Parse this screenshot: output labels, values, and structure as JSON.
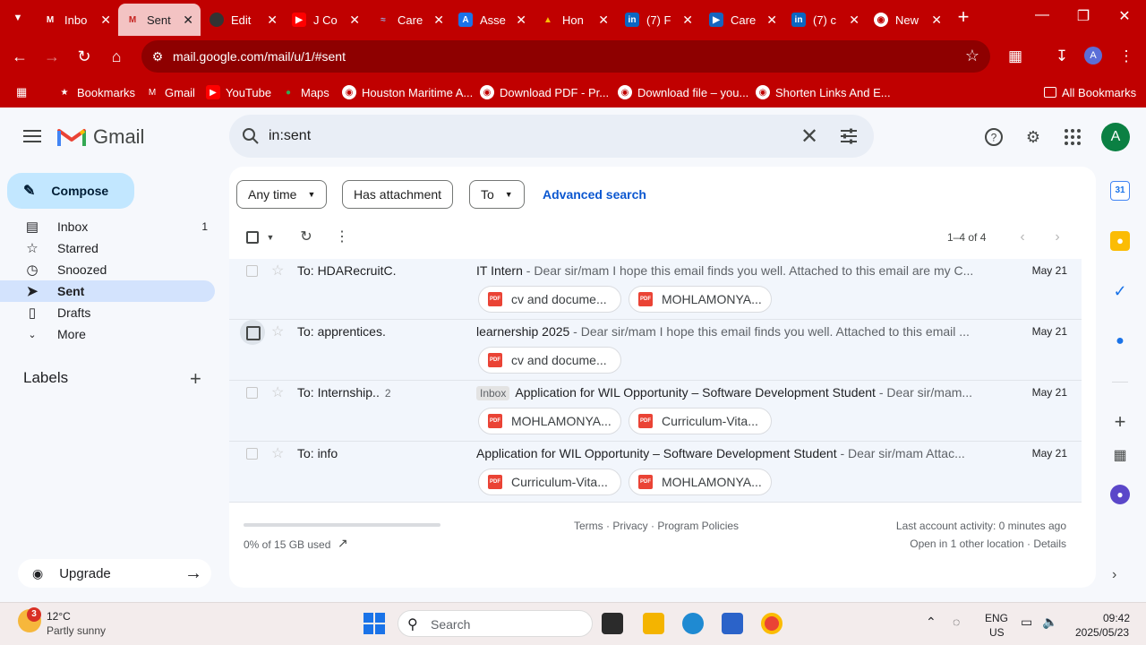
{
  "browser": {
    "tabs": [
      {
        "title": "Inbo",
        "favicon": "gmail-icon"
      },
      {
        "title": "Sent",
        "favicon": "gmail-icon"
      },
      {
        "title": "Edit",
        "favicon": "github-icon"
      },
      {
        "title": "J Co",
        "favicon": "youtube-icon"
      },
      {
        "title": "Care",
        "favicon": "career-icon"
      },
      {
        "title": "Asse",
        "favicon": "assessment-icon"
      },
      {
        "title": "Hon",
        "favicon": "drive-icon"
      },
      {
        "title": "(7) F",
        "favicon": "linkedin-icon"
      },
      {
        "title": "Care",
        "favicon": "career-icon"
      },
      {
        "title": "(7) c",
        "favicon": "linkedin-icon"
      },
      {
        "title": "New",
        "favicon": "chrome-icon"
      }
    ],
    "url": "mail.google.com/mail/u/1/#sent",
    "profile_initial": "A",
    "bookmarks": [
      "Bookmarks",
      "Gmail",
      "YouTube",
      "Maps",
      "Houston Maritime A...",
      "Download PDF - Pr...",
      "Download file – you...",
      "Shorten Links And E..."
    ],
    "all_bookmarks": "All Bookmarks",
    "theme_color": "#c00000"
  },
  "gmail": {
    "brand": "Gmail",
    "search_query": "in:sent",
    "avatar_initial": "A",
    "compose_label": "Compose",
    "nav": [
      {
        "label": "Inbox",
        "icon": "inbox-icon",
        "count": "1"
      },
      {
        "label": "Starred",
        "icon": "star-icon",
        "count": ""
      },
      {
        "label": "Snoozed",
        "icon": "clock-icon",
        "count": ""
      },
      {
        "label": "Sent",
        "icon": "send-icon",
        "count": ""
      },
      {
        "label": "Drafts",
        "icon": "draft-icon",
        "count": ""
      },
      {
        "label": "More",
        "icon": "chevron-down-icon",
        "count": ""
      }
    ],
    "labels_heading": "Labels",
    "upgrade_label": "Upgrade",
    "filters": {
      "any_time": "Any time",
      "has_attachment": "Has attachment",
      "to": "To",
      "advanced": "Advanced search"
    },
    "pager": "1–4 of 4",
    "emails": [
      {
        "to": "To: HDARecruitC.",
        "count": "",
        "tag": "",
        "subject": "IT Intern",
        "snippet": " - Dear sir/mam I hope this email finds you well. Attached to this email are my C...",
        "date": "May 21",
        "attachments": [
          "cv and docume...",
          "MOHLAMONYA..."
        ]
      },
      {
        "to": "To: apprentices.",
        "count": "",
        "tag": "",
        "subject": "learnership 2025",
        "snippet": " - Dear sir/mam I hope this email finds you well. Attached to this email ...",
        "date": "May 21",
        "attachments": [
          "cv and docume..."
        ]
      },
      {
        "to": "To: Internship..",
        "count": "2",
        "tag": "Inbox",
        "subject": "Application for WIL Opportunity – Software Development Student",
        "snippet": " - Dear sir/mam...",
        "date": "May 21",
        "attachments": [
          "MOHLAMONYA...",
          "Curriculum-Vita..."
        ]
      },
      {
        "to": "To: info",
        "count": "",
        "tag": "",
        "subject": "Application for WIL Opportunity – Software Development Student",
        "snippet": " - Dear sir/mam Attac...",
        "date": "May 21",
        "attachments": [
          "Curriculum-Vita...",
          "MOHLAMONYA..."
        ]
      }
    ],
    "storage_used": "0% of 15 GB used",
    "storage_fraction": 0.0,
    "footer_links": "Terms · Privacy · Program Policies",
    "activity_line1": "Last account activity: 0 minutes ago",
    "activity_line2": "Open in 1 other location · Details",
    "calendar_day": "31"
  },
  "taskbar": {
    "weather_badge": "3",
    "temperature": "12°C",
    "weather_desc": "Partly sunny",
    "search_placeholder": "Search",
    "lang1": "ENG",
    "lang2": "US",
    "time": "09:42",
    "date": "2025/05/23"
  }
}
